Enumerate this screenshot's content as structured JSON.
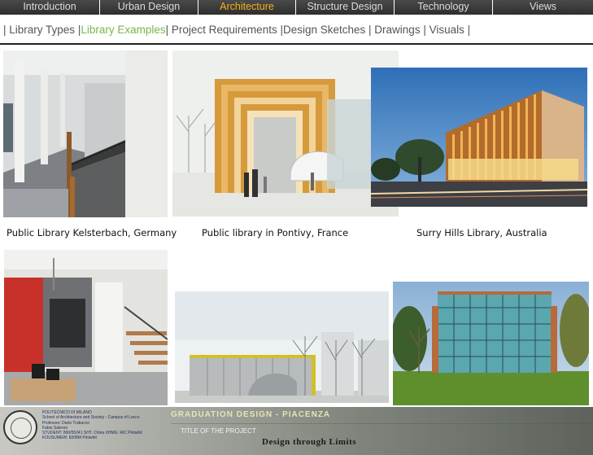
{
  "nav": {
    "tabs": [
      {
        "label": "Introduction",
        "active": false
      },
      {
        "label": "Urban Design",
        "active": false
      },
      {
        "label": "Architecture",
        "active": true
      },
      {
        "label": "Structure Design",
        "active": false
      },
      {
        "label": "Technology",
        "active": false
      },
      {
        "label": "Views",
        "active": false
      }
    ]
  },
  "subnav": {
    "items": [
      "Library Types",
      "Library Examples",
      "Project Requirements",
      "Design Sketches",
      "Drawings",
      "Visuals"
    ],
    "current": "Library Examples"
  },
  "captions": {
    "kelsterbach": "Public Library Kelsterbach, Germany",
    "pontivy": "Public library in Pontivy, France",
    "surry": "Surry Hills Library, Australia"
  },
  "footer": {
    "info_lines": [
      "POLITECNICO DI MILANO",
      "School of Architecture and Society - Campus of Lecco",
      "Professor: Dario Trabucco",
      "Fabio Salerno",
      "STUDENT: 800/55241 SHT. China   XHMG: RIC Pintwhit",
      "KOUSUMEW: 8208M  Pintwhit"
    ],
    "graduation": "GRADUATION DESIGN - PIACENZA",
    "project_title": "TITLE OF THE PROJECT",
    "tagline": "Design through Limits"
  },
  "colors": {
    "active_tab": "#f3b21a",
    "current_subnav": "#7ab648",
    "nav_bg": "#3a3a3a"
  }
}
